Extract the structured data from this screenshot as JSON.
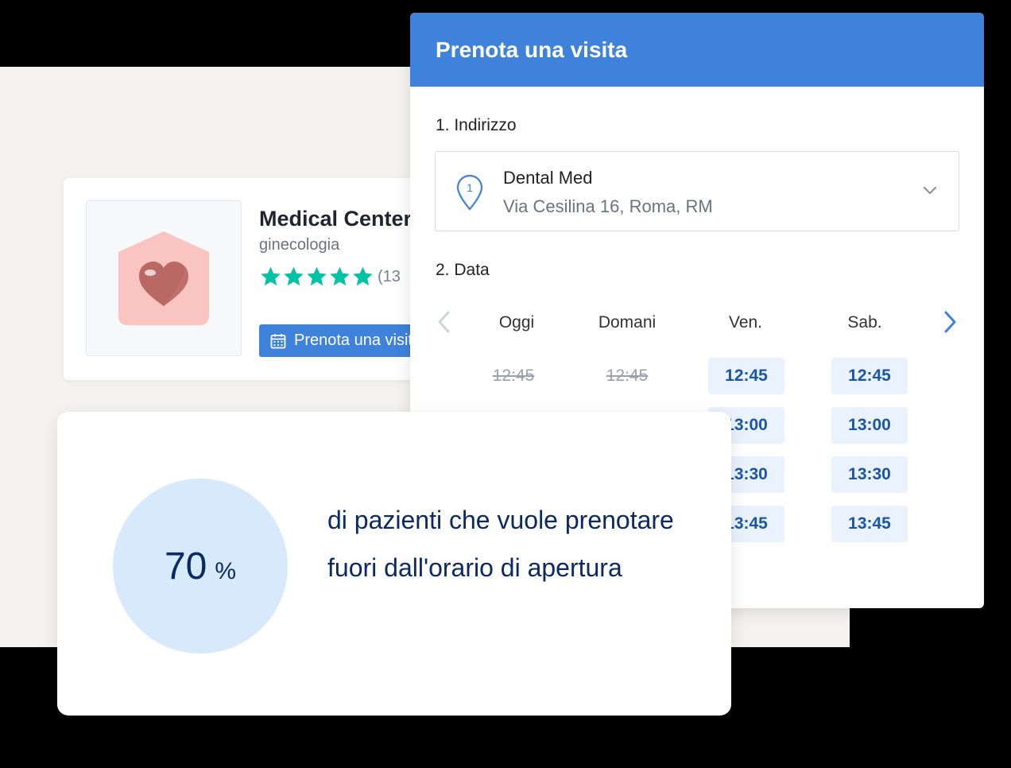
{
  "doctor_card": {
    "name": "Medical Center",
    "specialty": "ginecologia",
    "rating_stars": 5,
    "review_count_text": "(13",
    "book_button_label": "Prenota una visita"
  },
  "booking": {
    "title": "Prenota una visita",
    "address_section_label": "1. Indirizzo",
    "address": {
      "pin_number": "1",
      "name": "Dental Med",
      "street": "Via Cesilina 16, Roma, RM"
    },
    "date_section_label": "2. Data",
    "days": [
      "Oggi",
      "Domani",
      "Ven.",
      "Sab."
    ],
    "slots": [
      [
        "12:45"
      ],
      [
        "12:45"
      ],
      [
        "12:45",
        "13:00",
        "13:30",
        "13:45"
      ],
      [
        "12:45",
        "13:00",
        "13:30",
        "13:45"
      ]
    ],
    "slot_availability": [
      [
        false
      ],
      [
        false
      ],
      [
        true,
        true,
        true,
        true
      ],
      [
        true,
        true,
        true,
        true
      ]
    ]
  },
  "stats": {
    "value": "70",
    "unit": "%",
    "description": "di pazienti che vuole prenotare fuori dall'orario di apertura"
  },
  "colors": {
    "brand_blue": "#3f82dc",
    "star_green": "#00c3a5",
    "slot_bg": "#e9f2fd",
    "slot_text": "#1a56a8",
    "stat_circle": "#d7eafc",
    "stat_text": "#0b2a63"
  }
}
